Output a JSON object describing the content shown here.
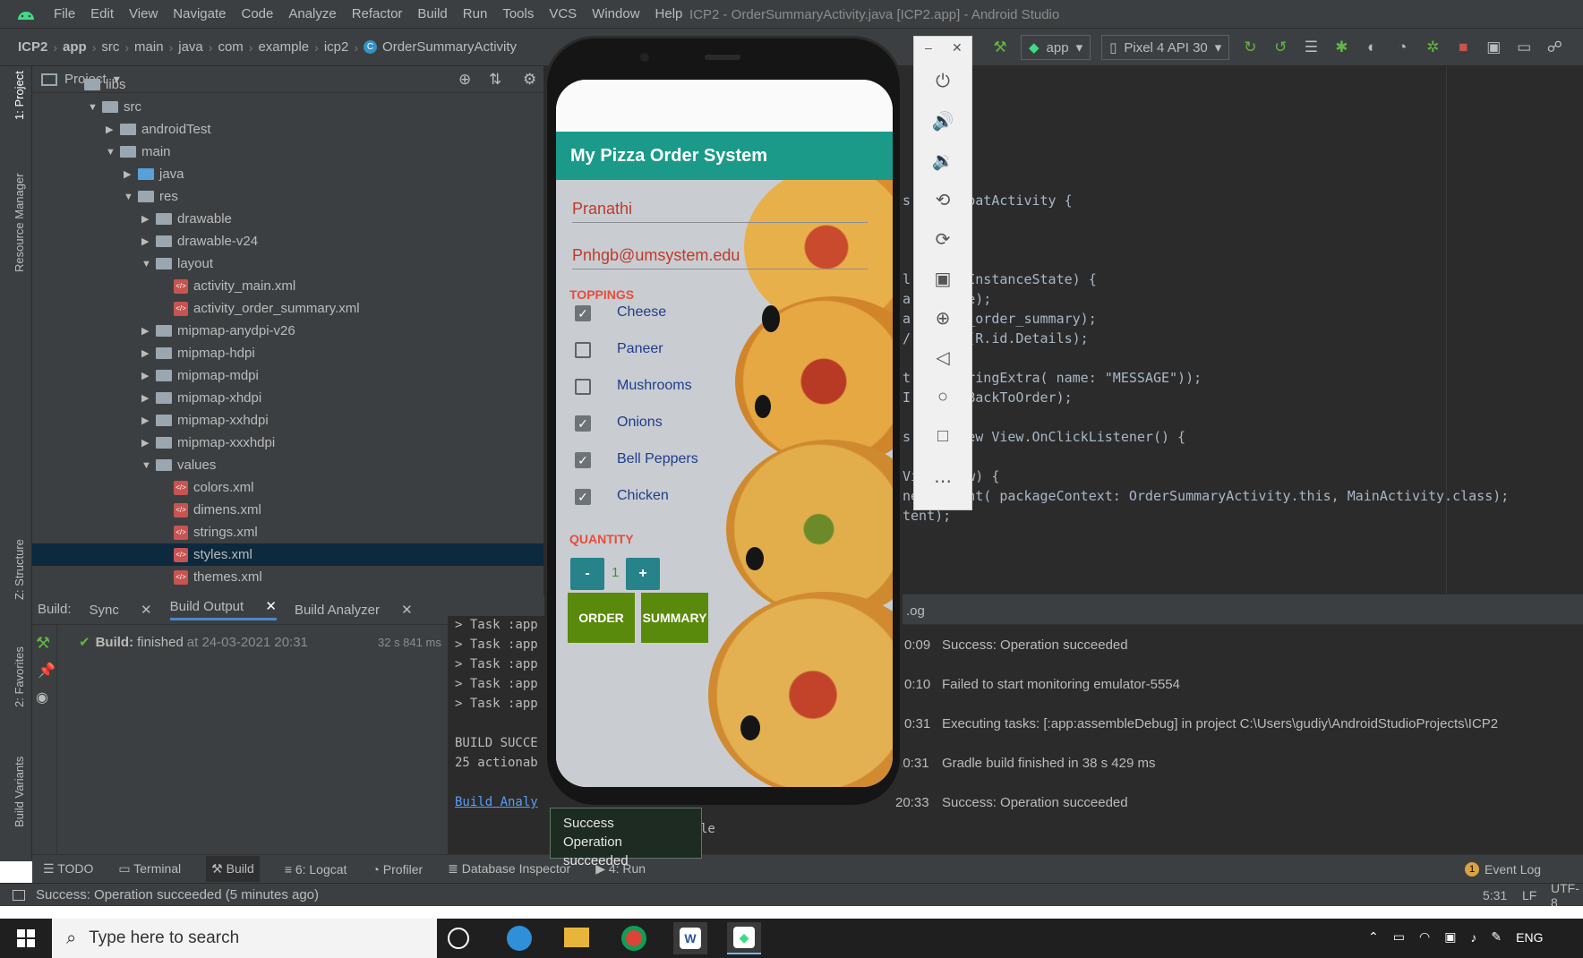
{
  "window": {
    "title": "ICP2 - OrderSummaryActivity.java [ICP2.app] - Android Studio",
    "menu": [
      "File",
      "Edit",
      "View",
      "Navigate",
      "Code",
      "Analyze",
      "Refactor",
      "Build",
      "Run",
      "Tools",
      "VCS",
      "Window",
      "Help"
    ]
  },
  "breadcrumb": [
    "ICP2",
    "app",
    "src",
    "main",
    "java",
    "com",
    "example",
    "icp2",
    "OrderSummaryActivity"
  ],
  "toolbar": {
    "config": "app",
    "device": "Pixel 4 API 30"
  },
  "side_tabs": {
    "project": "1: Project",
    "resource_manager": "Resource Manager",
    "structure": "Z: Structure",
    "favorites": "2: Favorites",
    "build_variants": "Build Variants"
  },
  "project_panel": {
    "title": "Project",
    "tree": [
      {
        "label": "libs",
        "indent": 0,
        "kind": "folder",
        "arrow": ""
      },
      {
        "label": "src",
        "indent": 1,
        "kind": "folder",
        "arrow": "▼"
      },
      {
        "label": "androidTest",
        "indent": 2,
        "kind": "folder",
        "arrow": "▶"
      },
      {
        "label": "main",
        "indent": 2,
        "kind": "folder",
        "arrow": "▼"
      },
      {
        "label": "java",
        "indent": 3,
        "kind": "folder-blue",
        "arrow": "▶"
      },
      {
        "label": "res",
        "indent": 3,
        "kind": "folder",
        "arrow": "▼"
      },
      {
        "label": "drawable",
        "indent": 4,
        "kind": "folder",
        "arrow": "▶"
      },
      {
        "label": "drawable-v24",
        "indent": 4,
        "kind": "folder",
        "arrow": "▶"
      },
      {
        "label": "layout",
        "indent": 4,
        "kind": "folder",
        "arrow": "▼"
      },
      {
        "label": "activity_main.xml",
        "indent": 5,
        "kind": "xml",
        "arrow": ""
      },
      {
        "label": "activity_order_summary.xml",
        "indent": 5,
        "kind": "xml",
        "arrow": ""
      },
      {
        "label": "mipmap-anydpi-v26",
        "indent": 4,
        "kind": "folder",
        "arrow": "▶"
      },
      {
        "label": "mipmap-hdpi",
        "indent": 4,
        "kind": "folder",
        "arrow": "▶"
      },
      {
        "label": "mipmap-mdpi",
        "indent": 4,
        "kind": "folder",
        "arrow": "▶"
      },
      {
        "label": "mipmap-xhdpi",
        "indent": 4,
        "kind": "folder",
        "arrow": "▶"
      },
      {
        "label": "mipmap-xxhdpi",
        "indent": 4,
        "kind": "folder",
        "arrow": "▶"
      },
      {
        "label": "mipmap-xxxhdpi",
        "indent": 4,
        "kind": "folder",
        "arrow": "▶"
      },
      {
        "label": "values",
        "indent": 4,
        "kind": "folder",
        "arrow": "▼"
      },
      {
        "label": "colors.xml",
        "indent": 5,
        "kind": "xml",
        "arrow": ""
      },
      {
        "label": "dimens.xml",
        "indent": 5,
        "kind": "xml",
        "arrow": ""
      },
      {
        "label": "strings.xml",
        "indent": 5,
        "kind": "xml",
        "arrow": ""
      },
      {
        "label": "styles.xml",
        "indent": 5,
        "kind": "xml",
        "arrow": "",
        "selected": true
      },
      {
        "label": "themes.xml",
        "indent": 5,
        "kind": "xml",
        "arrow": ""
      }
    ]
  },
  "editor": {
    "lines": [
      "s AppCompatActivity {",
      "",
      "",
      "",
      "l       InstanceState) {",
      "a       e);",
      "a       _order_summary);",
      "/       (R.id.Details);",
      "",
      "t       ringExtra( name: \"MESSAGE\"));",
      "I       BackToOrder);",
      "",
      "s       ew View.OnClickListener() {",
      "",
      "View view) {",
      "new Intent( packageContext: OrderSummaryActivity.this, MainActivity.class);",
      "tent);"
    ]
  },
  "build_panel": {
    "label": "Build:",
    "tabs": [
      "Sync",
      "Build Output",
      "Build Analyzer"
    ],
    "status_label": "Build:",
    "status_text": "finished",
    "status_at": "at 24-03-2021 20:31",
    "duration": "32 s 841 ms",
    "console": [
      "> Task :app",
      "> Task :app",
      "> Task :app",
      "> Task :app",
      "> Task :app",
      "",
      "BUILD SUCCE",
      "25 actionab",
      "",
      "Build Analy"
    ],
    "console_tail": "le"
  },
  "event_log": {
    "header": ".og",
    "entries": [
      {
        "time": "0:09",
        "text": "Success: Operation succeeded"
      },
      {
        "time": "0:10",
        "text": "Failed to start monitoring emulator-5554"
      },
      {
        "time": "0:31",
        "text": "Executing tasks: [:app:assembleDebug] in project C:\\Users\\gudiy\\AndroidStudioProjects\\ICP2"
      },
      {
        "time": "20:31",
        "text": "Gradle build finished in 38 s 429 ms"
      },
      {
        "time": "20:33",
        "text": "Success: Operation succeeded"
      }
    ]
  },
  "bottom_tools": [
    "TODO",
    "Terminal",
    "Build",
    "6: Logcat",
    "Profiler",
    "Database Inspector",
    "4: Run"
  ],
  "event_log_tab": "Event Log",
  "event_log_count": "1",
  "status": {
    "message": "Success: Operation succeeded (5 minutes ago)",
    "position": "5:31",
    "line_sep": "LF",
    "encoding": "UTF-8"
  },
  "toast": {
    "title": "Success",
    "message": "Operation succeeded"
  },
  "phone_app": {
    "title": "My Pizza Order System",
    "name": "Pranathi",
    "email": "Pnhgb@umsystem.edu",
    "toppings_label": "TOPPINGS",
    "toppings": [
      {
        "label": "Cheese",
        "checked": true
      },
      {
        "label": "Paneer",
        "checked": false
      },
      {
        "label": "Mushrooms",
        "checked": false
      },
      {
        "label": "Onions",
        "checked": true
      },
      {
        "label": "Bell Peppers",
        "checked": true
      },
      {
        "label": "Chicken",
        "checked": true
      }
    ],
    "quantity_label": "QUANTITY",
    "quantity": "1",
    "minus": "-",
    "plus": "+",
    "order_button": "ORDER",
    "summary_button": "SUMMARY"
  },
  "taskbar": {
    "search_placeholder": "Type here to search",
    "lang": "ENG"
  },
  "colors": {
    "ide_bg": "#3c3f41",
    "editor_bg": "#2b2b2b",
    "app_bar": "#1b9a8a",
    "order_green": "#5a8a0b",
    "qty_teal": "#27838a",
    "accent_red": "#e74c3c"
  }
}
